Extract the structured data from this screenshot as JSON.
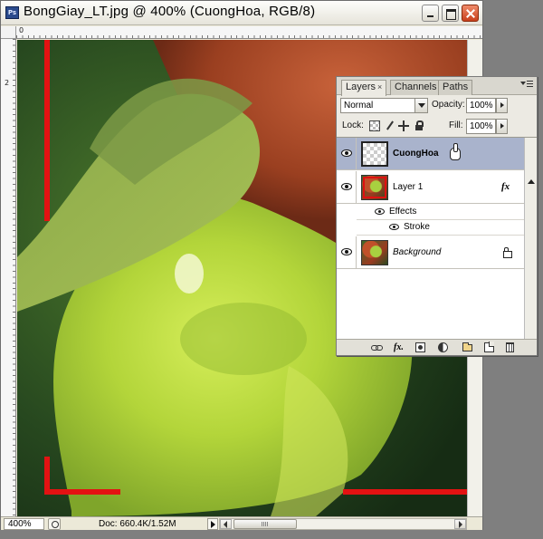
{
  "document": {
    "app_icon": "Ps",
    "title": "BongGiay_LT.jpg @ 400% (CuongHoa, RGB/8)",
    "ruler_marks": {
      "horizontal": "0",
      "vertical": "2"
    },
    "status": {
      "zoom": "400%",
      "doc_info": "Doc: 660.4K/1.52M"
    }
  },
  "canvas": {
    "icons": [
      "crop-corner-marks-red"
    ],
    "accent_color": "#e31212"
  },
  "layers_panel": {
    "tabs": [
      {
        "label": "Layers",
        "close": "×"
      },
      {
        "label": "Channels"
      },
      {
        "label": "Paths"
      }
    ],
    "blend_mode": "Normal",
    "opacity_label": "Opacity:",
    "opacity_value": "100%",
    "lock_label": "Lock:",
    "fill_label": "Fill:",
    "fill_value": "100%",
    "layers": [
      {
        "name": "CuongHoa",
        "selected": true,
        "visible": true
      },
      {
        "name": "Layer 1",
        "visible": true,
        "fx": "fx",
        "effects_label": "Effects",
        "effects": [
          "Stroke"
        ]
      },
      {
        "name": "Background",
        "visible": true,
        "locked": true
      }
    ],
    "bottom_icons": [
      "link-icon",
      "fx-icon",
      "mask-icon",
      "adjustment-icon",
      "group-icon",
      "new-layer-icon",
      "trash-icon"
    ],
    "bottom_fx_label": "fx."
  },
  "colors": {
    "selection": "#a9b3cc",
    "crop_marks": "#e31212"
  }
}
